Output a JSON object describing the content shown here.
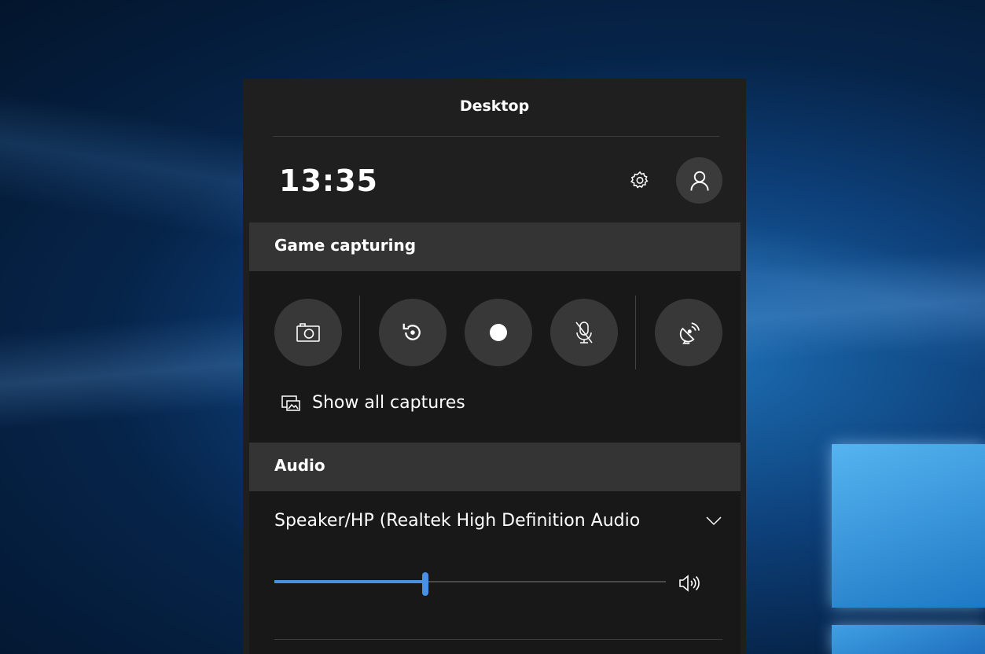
{
  "panel": {
    "title": "Desktop",
    "clock": "13:35"
  },
  "icons": {
    "settings": "gear-icon",
    "profile": "person-icon",
    "screenshot": "camera-icon",
    "record_last": "record-last-icon",
    "record": "record-dot-icon",
    "mic": "mic-off-icon",
    "broadcast": "broadcast-icon",
    "captures": "gallery-icon",
    "dropdown": "chevron-down-icon",
    "volume": "speaker-icon"
  },
  "capture": {
    "header": "Game capturing",
    "show_all_label": "Show all captures"
  },
  "audio": {
    "header": "Audio",
    "device": "Speaker/HP (Realtek High Definition Audio",
    "volume_fraction": 0.385
  },
  "colors": {
    "panel_bg": "#1f1f1f",
    "header_bg": "#343434",
    "accent": "#4a90e2"
  }
}
